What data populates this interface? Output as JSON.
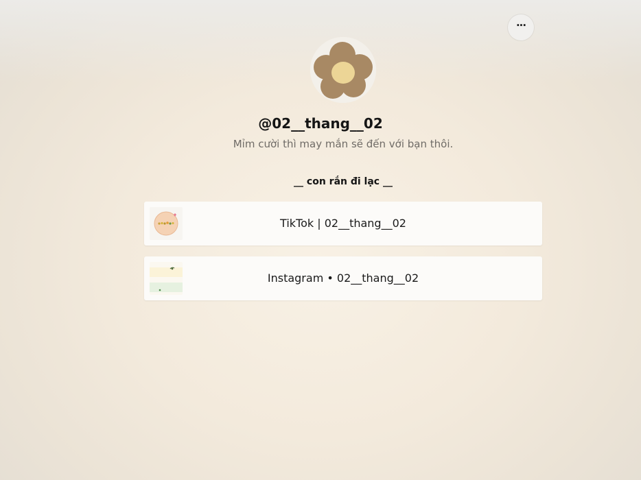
{
  "header": {
    "more_label": "···"
  },
  "profile": {
    "avatar_icon": "flower-icon",
    "name": "@02__thang__02",
    "bio": "Mỉm cười thì may mắn sẽ đến với bạn thôi."
  },
  "section": {
    "title": "__ con rắn đi lạc __"
  },
  "links": [
    {
      "label": "TikTok | 02__thang__02",
      "thumb_icon": "tiktok-thumbnail"
    },
    {
      "label": "Instagram • 02__thang__02",
      "thumb_icon": "instagram-thumbnail"
    }
  ],
  "colors": {
    "background": "#f3eadc",
    "card": "#fcfbf9",
    "flower_petal": "#a88964",
    "flower_center": "#ecd596",
    "text_primary": "#151515",
    "text_secondary": "#6f6b66"
  }
}
